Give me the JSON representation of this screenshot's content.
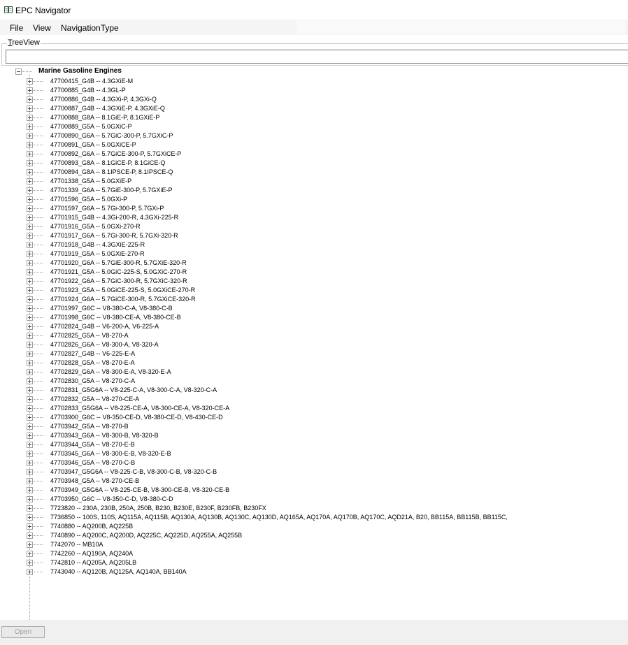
{
  "window": {
    "title": "EPC Navigator",
    "app_icon": "epc-book-icon"
  },
  "menubar": {
    "items": [
      "File",
      "View",
      "NavigationType"
    ]
  },
  "treeview_group": {
    "label_accel": "T",
    "label_rest": "reeView",
    "search_value": ""
  },
  "tree": {
    "root": "Marine Gasoline Engines",
    "nodes": [
      "47700415_G4B -- 4.3GXiE-M",
      "47700885_G4B -- 4.3GL-P",
      "47700886_G4B -- 4.3GXi-P, 4.3GXi-Q",
      "47700887_G4B -- 4.3GXiE-P, 4.3GXiE-Q",
      "47700888_G8A -- 8.1GiE-P, 8.1GXiE-P",
      "47700889_G5A -- 5.0GXiC-P",
      "47700890_G6A -- 5.7GiC-300-P, 5.7GXiC-P",
      "47700891_G5A -- 5.0GXiCE-P",
      "47700892_G6A -- 5.7GiCE-300-P, 5.7GXiCE-P",
      "47700893_G8A -- 8.1GiCE-P, 8.1GiCE-Q",
      "47700894_G8A -- 8.1IPSCE-P, 8.1IPSCE-Q",
      "47701338_G5A -- 5.0GXiE-P",
      "47701339_G6A -- 5.7GiE-300-P, 5.7GXiE-P",
      "47701596_G5A -- 5.0GXi-P",
      "47701597_G6A -- 5.7Gi-300-P, 5.7GXi-P",
      "47701915_G4B -- 4.3Gi-200-R, 4.3GXi-225-R",
      "47701916_G5A -- 5.0GXi-270-R",
      "47701917_G6A -- 5.7Gi-300-R, 5.7GXi-320-R",
      "47701918_G4B -- 4.3GXiE-225-R",
      "47701919_G5A -- 5.0GXiE-270-R",
      "47701920_G6A -- 5.7GiE-300-R, 5.7GXiE-320-R",
      "47701921_G5A -- 5.0GiC-225-S, 5.0GXiC-270-R",
      "47701922_G6A -- 5.7GiC-300-R, 5.7GXiC-320-R",
      "47701923_G5A -- 5.0GiCE-225-S, 5.0GXiCE-270-R",
      "47701924_G6A -- 5.7GiCE-300-R, 5.7GXiCE-320-R",
      "47701997_G6C -- V8-380-C-A, V8-380-C-B",
      "47701998_G6C -- V8-380-CE-A, V8-380-CE-B",
      "47702824_G4B -- V6-200-A, V6-225-A",
      "47702825_G5A -- V8-270-A",
      "47702826_G6A -- V8-300-A, V8-320-A",
      "47702827_G4B -- V6-225-E-A",
      "47702828_G5A -- V8-270-E-A",
      "47702829_G6A -- V8-300-E-A, V8-320-E-A",
      "47702830_G5A -- V8-270-C-A",
      "47702831_G5G6A -- V8-225-C-A, V8-300-C-A, V8-320-C-A",
      "47702832_G5A -- V8-270-CE-A",
      "47702833_G5G6A -- V8-225-CE-A, V8-300-CE-A, V8-320-CE-A",
      "47703900_G6C -- V8-350-CE-D, V8-380-CE-D, V8-430-CE-D",
      "47703942_G5A -- V8-270-B",
      "47703943_G6A -- V8-300-B, V8-320-B",
      "47703944_G5A -- V8-270-E-B",
      "47703945_G6A -- V8-300-E-B, V8-320-E-B",
      "47703946_G5A -- V8-270-C-B",
      "47703947_G5G6A -- V8-225-C-B, V8-300-C-B, V8-320-C-B",
      "47703948_G5A -- V8-270-CE-B",
      "47703949_G5G6A -- V8-225-CE-B, V8-300-CE-B, V8-320-CE-B",
      "47703950_G6C -- V8-350-C-D, V8-380-C-D",
      "7723820 -- 230A, 230B, 250A, 250B, B230, B230E, B230F, B230FB, B230FX",
      "7736850 -- 100S, 110S, AQ115A, AQ115B, AQ130A, AQ130B, AQ130C, AQ130D, AQ165A, AQ170A, AQ170B, AQ170C, AQD21A, B20, BB115A, BB115B, BB115C,",
      "7740880 -- AQ200B, AQ225B",
      "7740890 -- AQ200C, AQ200D, AQ225C, AQ225D, AQ255A, AQ255B",
      "7742070 -- MB10A",
      "7742260 -- AQ190A, AQ240A",
      "7742810 -- AQ205A, AQ205LB",
      "7743040 -- AQ120B, AQ125A, AQ140A, BB140A"
    ]
  },
  "footer": {
    "open_label": "Open"
  }
}
